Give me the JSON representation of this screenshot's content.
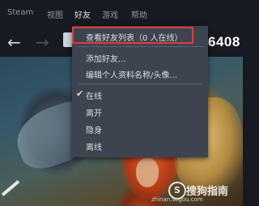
{
  "menubar": {
    "items": [
      "Steam",
      "视图",
      "好友",
      "游戏",
      "帮助"
    ],
    "active_index": 2
  },
  "nav": {
    "back_icon": "arrow-left-icon",
    "forward_icon": "arrow-right-icon",
    "title_partial": "6408"
  },
  "dropdown": {
    "items": [
      {
        "label": "查看好友列表（0 人在线）",
        "highlighted": true
      },
      {
        "label": "添加好友..."
      },
      {
        "label": "编辑个人资料名称/头像..."
      },
      {
        "label": "在线",
        "checked": true
      },
      {
        "label": "离开"
      },
      {
        "label": "隐身"
      },
      {
        "label": "离线"
      }
    ],
    "highlight_color": "#e23b3b"
  },
  "watermark": {
    "text": "搜狗指南",
    "url": "zhinan.sogou.com"
  },
  "colors": {
    "background": "#171a21",
    "menu_bg": "#3d4450",
    "text": "#dcdedf",
    "muted_text": "#8f98a0"
  }
}
